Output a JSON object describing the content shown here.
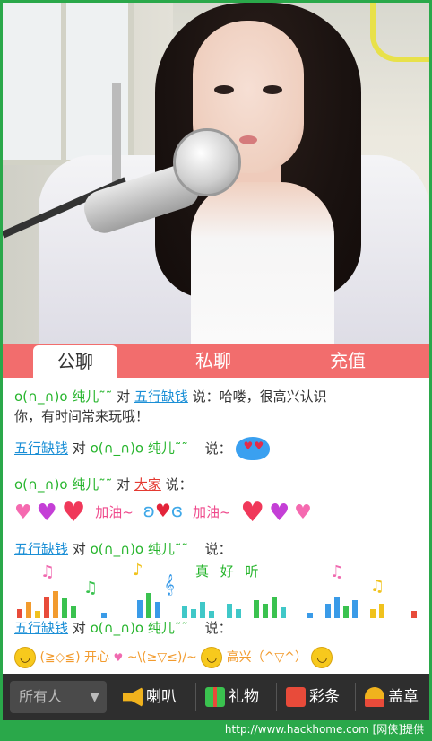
{
  "tabs": [
    "公聊",
    "私聊",
    "充值"
  ],
  "chat": {
    "msg1": {
      "from": "ο(∩_∩)ο 纯儿˜˜",
      "to_word": "对",
      "to": "五行缺钱",
      "say": "说：哈喽，很高兴认识",
      "say2": "你，有时间常来玩哦！"
    },
    "msg2": {
      "from": "五行缺钱",
      "to_word": "对",
      "to": "ο(∩_∩)ο 纯儿˜˜",
      "say": "说："
    },
    "msg3": {
      "from": "ο(∩_∩)ο 纯儿˜˜",
      "to_word": "对",
      "to": "大家",
      "say": "说：",
      "cheer1": "加油~",
      "cheer2": "加油~"
    },
    "msg4": {
      "from": "五行缺钱",
      "to_word": "对",
      "to": "ο(∩_∩)ο 纯儿˜˜",
      "say": "说：",
      "wave_text": "真 好 听"
    },
    "msg5": {
      "from": "五行缺钱",
      "to_word": "对",
      "to": "ο(∩_∩)ο 纯儿˜˜",
      "say": "说：",
      "emote1": "(≧◇≦) 开心",
      "emote2": "~\\(≥▽≤)/~",
      "emote3": "高兴（^▽^）"
    }
  },
  "toolbar": {
    "select": "所有人",
    "horn": "喇叭",
    "gift": "礼物",
    "ribbon": "彩条",
    "stamp": "盖章"
  },
  "watermark": "http://www.hackhome.com [网侠]提供",
  "colors": {
    "tab_bar": "#f26d6d",
    "name_green": "#27b52d",
    "link_blue": "#1b8fd6",
    "toolbar": "#2e2e2e",
    "frame": "#2aa84a"
  }
}
